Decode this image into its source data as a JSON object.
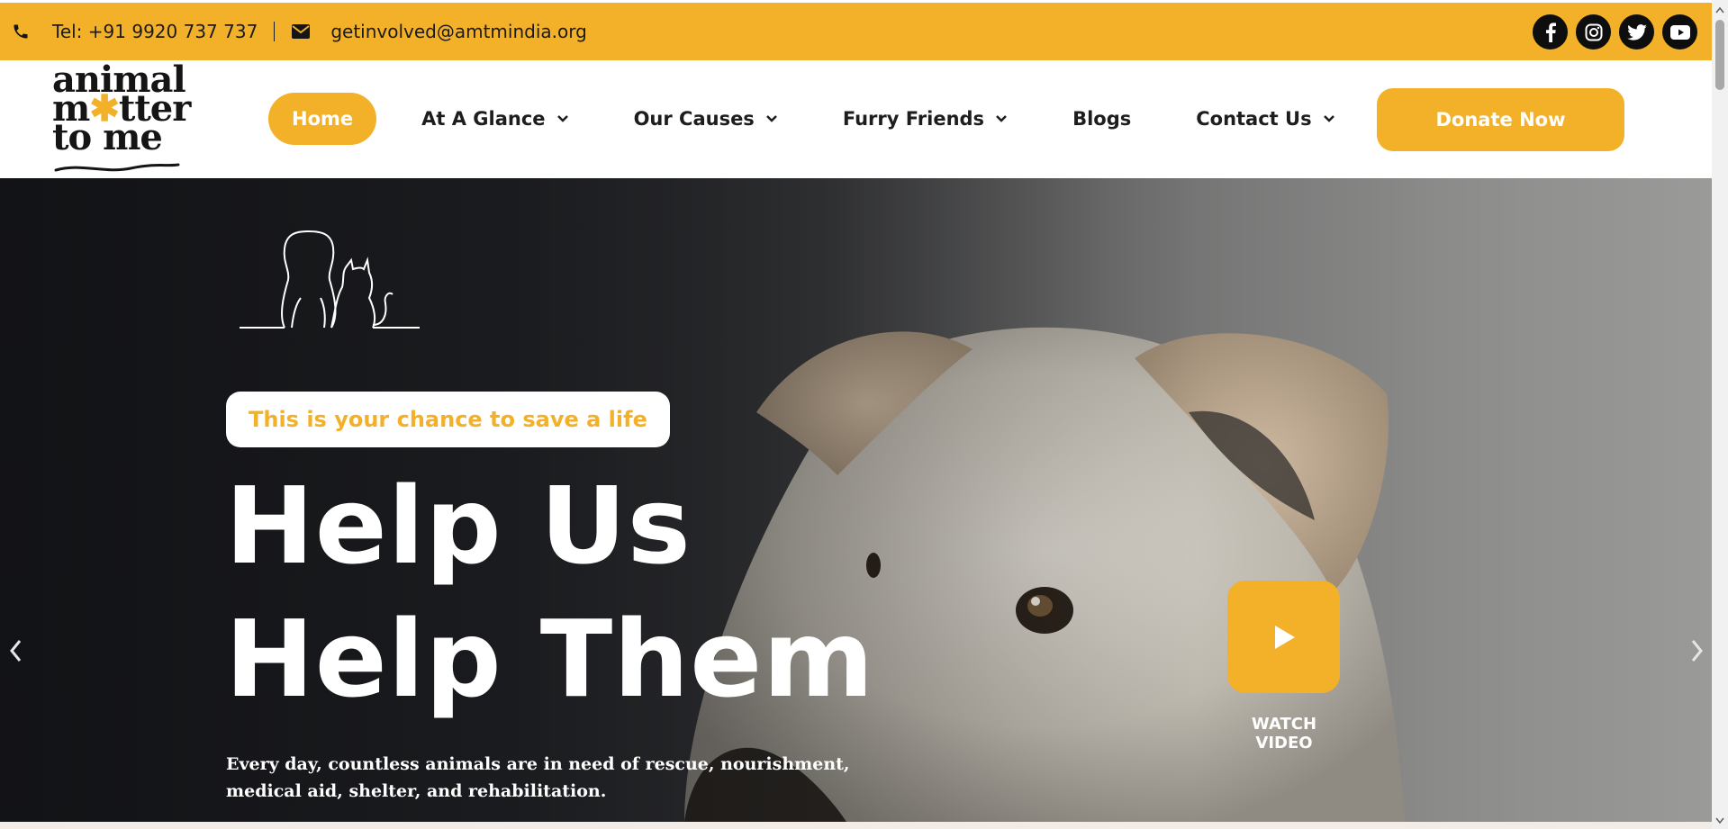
{
  "topbar": {
    "phone": "Tel: +91 9920 737 737",
    "email": "getinvolved@amtmindia.org",
    "social": [
      "facebook-icon",
      "instagram-icon",
      "twitter-icon",
      "youtube-icon"
    ]
  },
  "logo": {
    "line1": "animal",
    "line2_pre": "m",
    "line2_post": "tter",
    "line3": "to me"
  },
  "nav": {
    "items": [
      {
        "label": "Home"
      },
      {
        "label": "At A Glance"
      },
      {
        "label": "Our Causes"
      },
      {
        "label": "Furry Friends"
      },
      {
        "label": "Blogs"
      },
      {
        "label": "Contact Us"
      }
    ],
    "donate": "Donate Now"
  },
  "hero": {
    "tagline": "This is your chance to save a life",
    "headline_1": "Help Us",
    "headline_2": "Help Them",
    "description": "Every day, countless animals are in need of rescue, nourishment, medical aid, shelter, and rehabilitation.",
    "watch_label": "WATCH VIDEO"
  },
  "colors": {
    "accent": "#F2B129",
    "dark": "#151515",
    "white": "#FFFFFF"
  }
}
